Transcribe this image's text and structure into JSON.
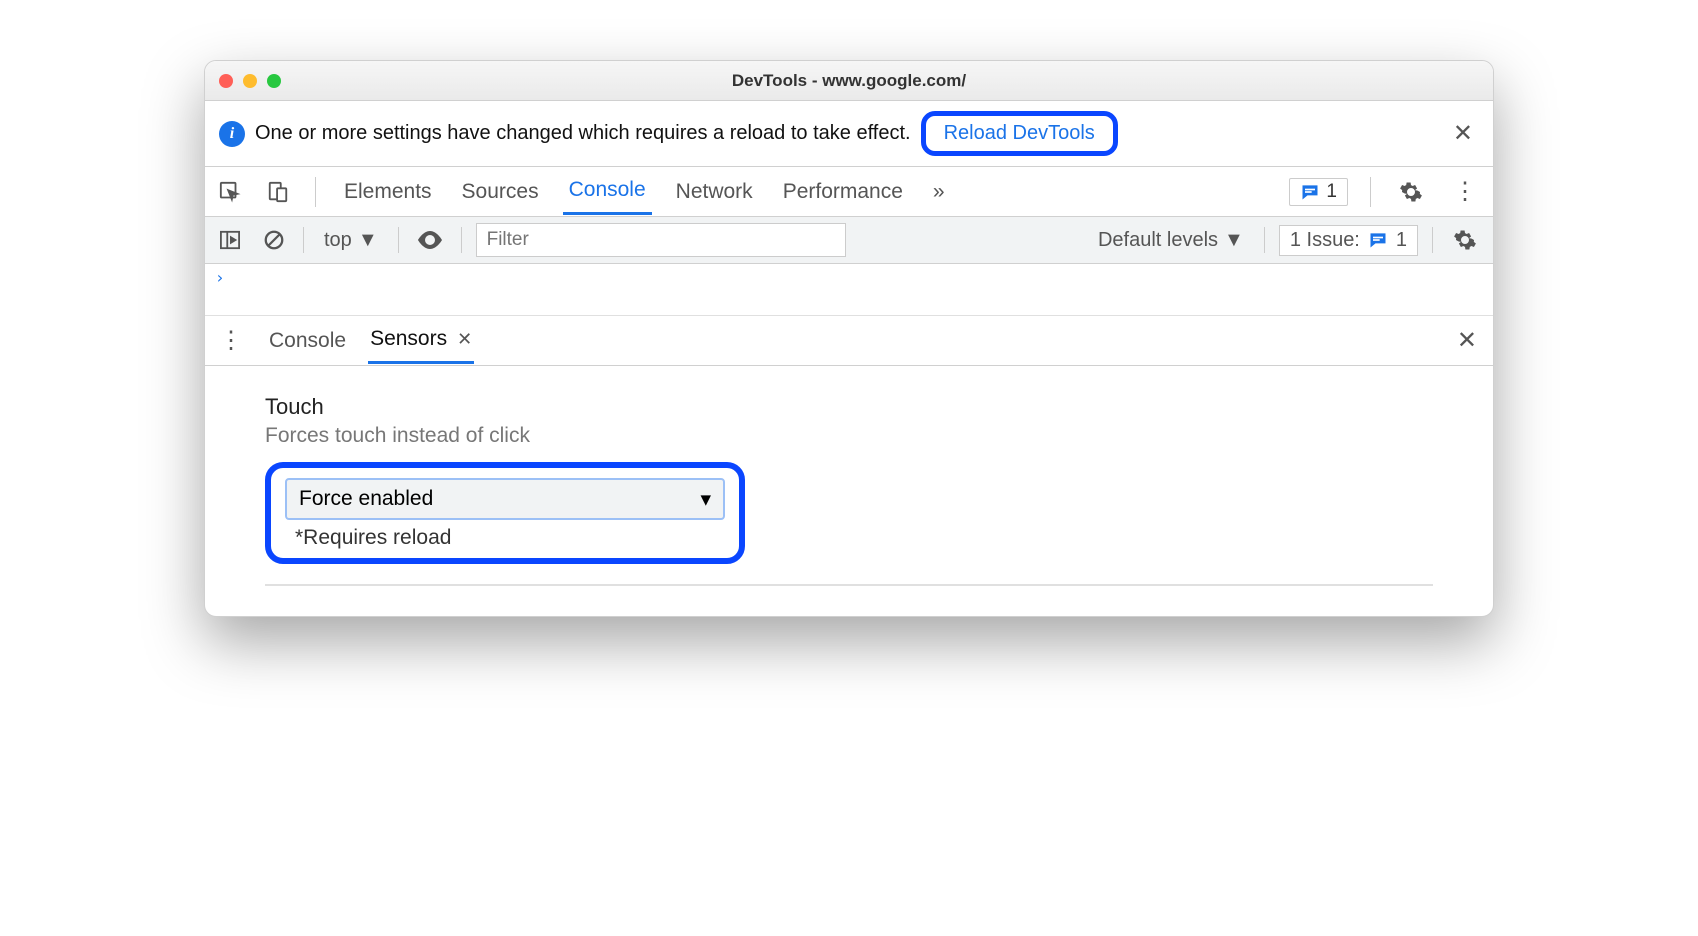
{
  "titlebar": {
    "title": "DevTools - www.google.com/"
  },
  "infobar": {
    "message": "One or more settings have changed which requires a reload to take effect.",
    "reload_label": "Reload DevTools"
  },
  "tabs": {
    "items": [
      "Elements",
      "Sources",
      "Console",
      "Network",
      "Performance"
    ],
    "active": "Console",
    "more": "»",
    "messages_count": "1"
  },
  "console_toolbar": {
    "context": "top",
    "filter_placeholder": "Filter",
    "levels": "Default levels",
    "issues_label": "1 Issue:",
    "issues_count": "1"
  },
  "console_body": {
    "prompt": "›"
  },
  "drawer": {
    "tabs": [
      "Console",
      "Sensors"
    ],
    "active": "Sensors"
  },
  "sensors": {
    "touch_label": "Touch",
    "touch_desc": "Forces touch instead of click",
    "select_value": "Force enabled",
    "requires": "*Requires reload"
  }
}
